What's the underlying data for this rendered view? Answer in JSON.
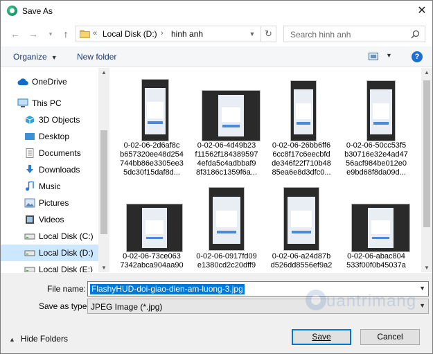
{
  "window": {
    "title": "Save As"
  },
  "address": {
    "prefix": "«",
    "crumbs": [
      "Local Disk (D:)",
      "hinh anh"
    ],
    "separator": "›"
  },
  "search": {
    "placeholder": "Search hinh anh"
  },
  "toolbar": {
    "organize_label": "Organize",
    "new_folder_label": "New folder",
    "help_label": "?"
  },
  "sidebar": {
    "items": [
      {
        "label": "OneDrive",
        "icon": "cloud-icon",
        "color": "#0f6cc9"
      },
      {
        "label": "This PC",
        "icon": "computer-icon",
        "color": "#2d7fc9"
      },
      {
        "label": "3D Objects",
        "icon": "cube-icon",
        "color": "#31a3d9"
      },
      {
        "label": "Desktop",
        "icon": "desktop-icon",
        "color": "#3d8fd6"
      },
      {
        "label": "Documents",
        "icon": "document-icon",
        "color": "#8a8a8a"
      },
      {
        "label": "Downloads",
        "icon": "download-icon",
        "color": "#2a7cd1"
      },
      {
        "label": "Music",
        "icon": "music-icon",
        "color": "#2a7cd1"
      },
      {
        "label": "Pictures",
        "icon": "picture-icon",
        "color": "#5a86b8"
      },
      {
        "label": "Videos",
        "icon": "video-icon",
        "color": "#4a4a4a"
      },
      {
        "label": "Local Disk (C:)",
        "icon": "drive-icon",
        "color": "#6a6a6a"
      },
      {
        "label": "Local Disk (D:)",
        "icon": "drive-icon",
        "color": "#6a6a6a",
        "selected": true
      },
      {
        "label": "Local Disk (E:)",
        "icon": "drive-icon",
        "color": "#6a6a6a"
      }
    ]
  },
  "files": [
    {
      "name": "0-02-06-2d6af8c\nb657320ee48d254\n744bb86e3305ee3\n5dc30f15daf8d..."
    },
    {
      "name": "0-02-06-4d49b23\nf11562f184389597\n4efda5c4adbbaf9\n8f3186c1359f6a..."
    },
    {
      "name": "0-02-06-26bb6ff6\n6cc8f17c6eecbfd\nde346f22f710b48\n85ea6e8d3dfc0..."
    },
    {
      "name": "0-02-06-50cc53f5\nb30716e32e4ad47\n56acf984be012e0\ne9bd68f8da09d..."
    },
    {
      "name": "0-02-06-73ce063\n7342abca904aa90"
    },
    {
      "name": "0-02-06-0917fd09\ne1380cd2c20dff9"
    },
    {
      "name": "0-02-06-a24d87b\nd526dd8556ef9a2"
    },
    {
      "name": "0-02-06-abac804\n533f00f0b45037a"
    }
  ],
  "form": {
    "filename_label": "File name:",
    "filename_value": "FlashyHUD-doi-giao-dien-am-luong-3.jpg",
    "type_label": "Save as type:",
    "type_value": "JPEG Image (*.jpg)"
  },
  "footer": {
    "hide_folders_label": "Hide Folders",
    "save_label": "Save",
    "cancel_label": "Cancel"
  },
  "watermark": {
    "text": "uantrimang"
  },
  "colors": {
    "accent": "#0078d7",
    "selected_bg": "#cce8ff",
    "link": "#1e3a6e"
  }
}
